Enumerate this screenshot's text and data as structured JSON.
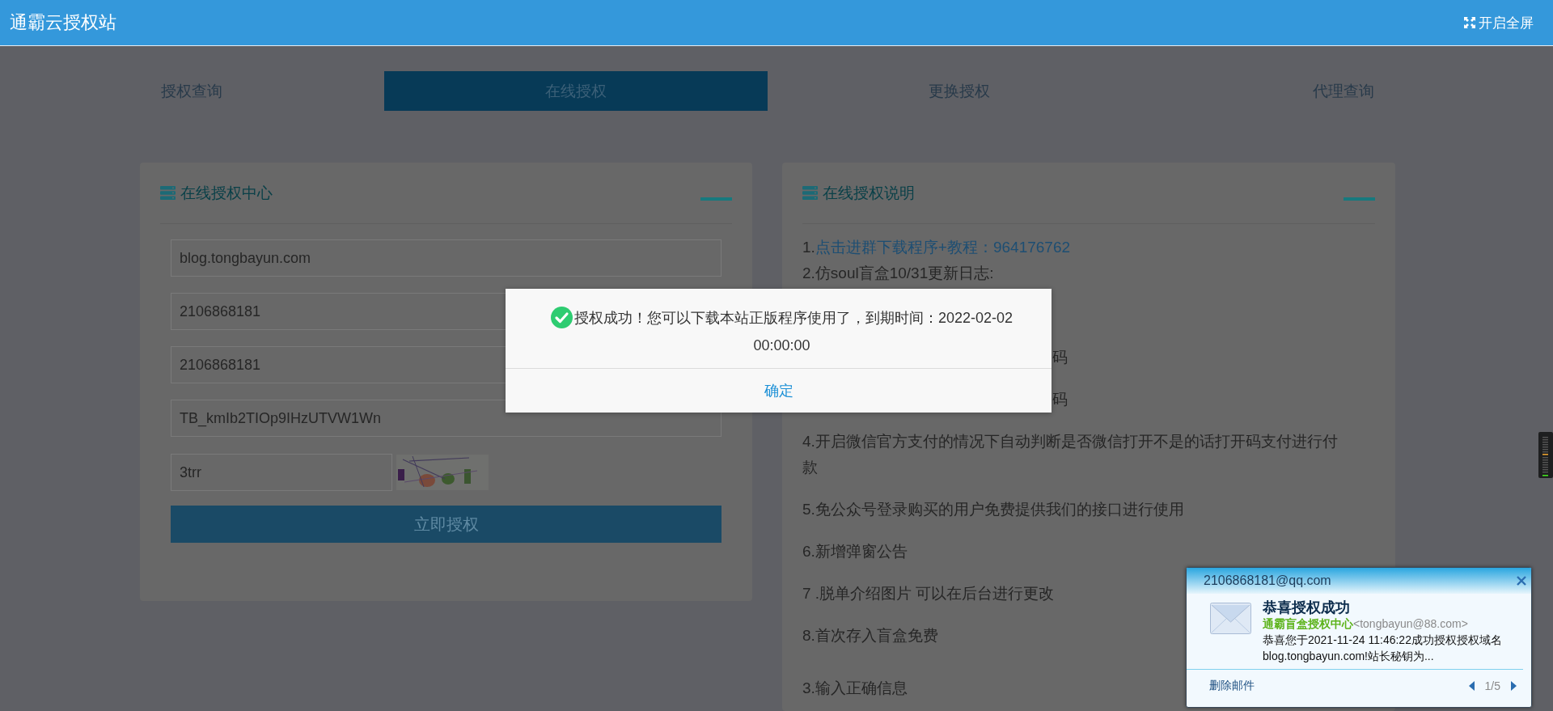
{
  "header": {
    "title": "通霸云授权站",
    "fullscreen": "开启全屏"
  },
  "tabs": [
    {
      "label": "授权查询",
      "selected": false
    },
    {
      "label": "在线授权",
      "selected": true
    },
    {
      "label": "更换授权",
      "selected": false
    },
    {
      "label": "代理查询",
      "selected": false
    }
  ],
  "auth_panel": {
    "title": "在线授权中心",
    "fields": [
      {
        "value": "blog.tongbayun.com"
      },
      {
        "value": "2106868181"
      },
      {
        "value": "2106868181"
      },
      {
        "value": "TB_kmIb2TIOp9IHzUTVW1Wn"
      }
    ],
    "captcha": {
      "value": "3trr"
    },
    "submit": "立即授权"
  },
  "info_panel": {
    "title": "在线授权说明",
    "items": [
      {
        "kind": "link",
        "prefix": "1.",
        "text": "点击进群下载程序+教程：964176762"
      },
      {
        "kind": "text",
        "text": "2.仿soul盲盒10/31更新日志:"
      },
      {
        "kind": "covered",
        "text": "码"
      },
      {
        "kind": "covered",
        "text": "码"
      },
      {
        "kind": "text",
        "text": "4.开启微信官方支付的情况下自动判断是否微信打开不是的话打开码支付进行付款"
      },
      {
        "kind": "text",
        "text": "5.免公众号登录购买的用户免费提供我们的接口进行使用"
      },
      {
        "kind": "text",
        "text": "6.新增弹窗公告"
      },
      {
        "kind": "text",
        "text": "7 .脱单介绍图片 可以在后台进行更改"
      },
      {
        "kind": "text",
        "text": "8.首次存入盲盒免费"
      },
      {
        "kind": "section",
        "text": "3.输入正确信息"
      }
    ]
  },
  "alert": {
    "message": "授权成功！您可以下载本站正版程序使用了，到期时间：2022-02-02 00:00:00",
    "button": "确定"
  },
  "mail_popup": {
    "account": "2106868181@qq.com",
    "subject": "恭喜授权成功",
    "sender_name": "通霸盲盒授权中心",
    "sender_address": "<tongbayun@88.com>",
    "body": "恭喜您于2021-11-24 11:46:22成功授权授权域名blog.tongbayun.com!站长秘钥为...",
    "delete": "删除邮件",
    "page": "1/5"
  }
}
